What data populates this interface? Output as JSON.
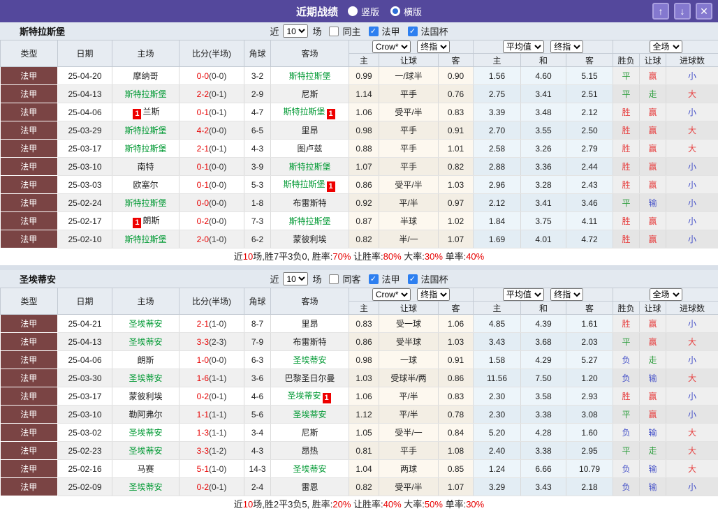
{
  "titlebar": {
    "title": "近期战绩",
    "radios": [
      {
        "label": "竖版",
        "selected": true
      },
      {
        "label": "横版",
        "selected": false
      }
    ],
    "buttons": {
      "up": "↑",
      "down": "↓",
      "close": "✕"
    }
  },
  "colors": {
    "topbar": "#54489c",
    "type_column": "#7a4444",
    "focus_team": "#009933",
    "score_red": "#e60000",
    "win_red": "#e64040",
    "draw_green": "#2f9e3f",
    "lose_blue": "#4450c8"
  },
  "header": {
    "cols": [
      "类型",
      "日期",
      "主场",
      "比分(半场)",
      "角球",
      "客场"
    ],
    "sub": [
      "主",
      "让球",
      "客",
      "主",
      "和",
      "客",
      "胜负",
      "让球",
      "进球数"
    ],
    "selects": {
      "crow": "Crow*",
      "final": "终指",
      "avg": "平均值",
      "full": "全场"
    }
  },
  "result_color_map": {
    "胜": "c-red",
    "平": "c-green",
    "负": "c-blue",
    "赢": "c-red",
    "走": "c-green",
    "输": "c-blue",
    "大": "c-red",
    "小": "c-blue"
  },
  "tables": [
    {
      "team": "斯特拉斯堡",
      "filter": {
        "near": "近",
        "count": "10",
        "games": "场",
        "checks": [
          {
            "label": "同主",
            "checked": false
          },
          {
            "label": "法甲",
            "checked": true
          },
          {
            "label": "法国杯",
            "checked": true
          }
        ]
      },
      "rows": [
        {
          "type": "法甲",
          "date": "25-04-20",
          "home": "摩纳哥",
          "home_focus": false,
          "home_card": "",
          "ft": "0-0",
          "ht": "(0-0)",
          "corner": "3-2",
          "away": "斯特拉斯堡",
          "away_focus": true,
          "away_card": "",
          "odds": [
            "0.99",
            "一/球半",
            "0.90"
          ],
          "avg": [
            "1.56",
            "4.60",
            "5.15"
          ],
          "results": [
            "平",
            "赢",
            "小"
          ]
        },
        {
          "type": "法甲",
          "date": "25-04-13",
          "home": "斯特拉斯堡",
          "home_focus": true,
          "home_card": "",
          "ft": "2-2",
          "ht": "(0-1)",
          "corner": "2-9",
          "away": "尼斯",
          "away_focus": false,
          "away_card": "",
          "odds": [
            "1.14",
            "平手",
            "0.76"
          ],
          "avg": [
            "2.75",
            "3.41",
            "2.51"
          ],
          "results": [
            "平",
            "走",
            "大"
          ]
        },
        {
          "type": "法甲",
          "date": "25-04-06",
          "home": "兰斯",
          "home_focus": false,
          "home_card": "before",
          "ft": "0-1",
          "ht": "(0-1)",
          "corner": "4-7",
          "away": "斯特拉斯堡",
          "away_focus": true,
          "away_card": "after",
          "odds": [
            "1.06",
            "受平/半",
            "0.83"
          ],
          "avg": [
            "3.39",
            "3.48",
            "2.12"
          ],
          "results": [
            "胜",
            "赢",
            "小"
          ]
        },
        {
          "type": "法甲",
          "date": "25-03-29",
          "home": "斯特拉斯堡",
          "home_focus": true,
          "home_card": "",
          "ft": "4-2",
          "ht": "(0-0)",
          "corner": "6-5",
          "away": "里昂",
          "away_focus": false,
          "away_card": "",
          "odds": [
            "0.98",
            "平手",
            "0.91"
          ],
          "avg": [
            "2.70",
            "3.55",
            "2.50"
          ],
          "results": [
            "胜",
            "赢",
            "大"
          ]
        },
        {
          "type": "法甲",
          "date": "25-03-17",
          "home": "斯特拉斯堡",
          "home_focus": true,
          "home_card": "",
          "ft": "2-1",
          "ht": "(0-1)",
          "corner": "4-3",
          "away": "图卢兹",
          "away_focus": false,
          "away_card": "",
          "odds": [
            "0.88",
            "平手",
            "1.01"
          ],
          "avg": [
            "2.58",
            "3.26",
            "2.79"
          ],
          "results": [
            "胜",
            "赢",
            "大"
          ]
        },
        {
          "type": "法甲",
          "date": "25-03-10",
          "home": "南特",
          "home_focus": false,
          "home_card": "",
          "ft": "0-1",
          "ht": "(0-0)",
          "corner": "3-9",
          "away": "斯特拉斯堡",
          "away_focus": true,
          "away_card": "",
          "odds": [
            "1.07",
            "平手",
            "0.82"
          ],
          "avg": [
            "2.88",
            "3.36",
            "2.44"
          ],
          "results": [
            "胜",
            "赢",
            "小"
          ]
        },
        {
          "type": "法甲",
          "date": "25-03-03",
          "home": "欧塞尔",
          "home_focus": false,
          "home_card": "",
          "ft": "0-1",
          "ht": "(0-0)",
          "corner": "5-3",
          "away": "斯特拉斯堡",
          "away_focus": true,
          "away_card": "after",
          "odds": [
            "0.86",
            "受平/半",
            "1.03"
          ],
          "avg": [
            "2.96",
            "3.28",
            "2.43"
          ],
          "results": [
            "胜",
            "赢",
            "小"
          ]
        },
        {
          "type": "法甲",
          "date": "25-02-24",
          "home": "斯特拉斯堡",
          "home_focus": true,
          "home_card": "",
          "ft": "0-0",
          "ht": "(0-0)",
          "corner": "1-8",
          "away": "布雷斯特",
          "away_focus": false,
          "away_card": "",
          "odds": [
            "0.92",
            "平/半",
            "0.97"
          ],
          "avg": [
            "2.12",
            "3.41",
            "3.46"
          ],
          "results": [
            "平",
            "输",
            "小"
          ]
        },
        {
          "type": "法甲",
          "date": "25-02-17",
          "home": "朗斯",
          "home_focus": false,
          "home_card": "before",
          "ft": "0-2",
          "ht": "(0-0)",
          "corner": "7-3",
          "away": "斯特拉斯堡",
          "away_focus": true,
          "away_card": "",
          "odds": [
            "0.87",
            "半球",
            "1.02"
          ],
          "avg": [
            "1.84",
            "3.75",
            "4.11"
          ],
          "results": [
            "胜",
            "赢",
            "小"
          ]
        },
        {
          "type": "法甲",
          "date": "25-02-10",
          "home": "斯特拉斯堡",
          "home_focus": true,
          "home_card": "",
          "ft": "2-0",
          "ht": "(1-0)",
          "corner": "6-2",
          "away": "蒙彼利埃",
          "away_focus": false,
          "away_card": "",
          "odds": [
            "0.82",
            "半/一",
            "1.07"
          ],
          "avg": [
            "1.69",
            "4.01",
            "4.72"
          ],
          "results": [
            "胜",
            "赢",
            "小"
          ]
        }
      ],
      "summary": [
        {
          "t": "近",
          "c": "k"
        },
        {
          "t": "10",
          "c": "r"
        },
        {
          "t": "场,胜7平3负0, 胜率:",
          "c": "k"
        },
        {
          "t": "70%",
          "c": "r"
        },
        {
          "t": " 让胜率:",
          "c": "k"
        },
        {
          "t": "80%",
          "c": "r"
        },
        {
          "t": " 大率:",
          "c": "k"
        },
        {
          "t": "30%",
          "c": "r"
        },
        {
          "t": " 单率:",
          "c": "k"
        },
        {
          "t": "40%",
          "c": "r"
        }
      ]
    },
    {
      "team": "圣埃蒂安",
      "filter": {
        "near": "近",
        "count": "10",
        "games": "场",
        "checks": [
          {
            "label": "同客",
            "checked": false
          },
          {
            "label": "法甲",
            "checked": true
          },
          {
            "label": "法国杯",
            "checked": true
          }
        ]
      },
      "rows": [
        {
          "type": "法甲",
          "date": "25-04-21",
          "home": "圣埃蒂安",
          "home_focus": true,
          "home_card": "",
          "ft": "2-1",
          "ht": "(1-0)",
          "corner": "8-7",
          "away": "里昂",
          "away_focus": false,
          "away_card": "",
          "odds": [
            "0.83",
            "受一球",
            "1.06"
          ],
          "avg": [
            "4.85",
            "4.39",
            "1.61"
          ],
          "results": [
            "胜",
            "赢",
            "小"
          ]
        },
        {
          "type": "法甲",
          "date": "25-04-13",
          "home": "圣埃蒂安",
          "home_focus": true,
          "home_card": "",
          "ft": "3-3",
          "ht": "(2-3)",
          "corner": "7-9",
          "away": "布雷斯特",
          "away_focus": false,
          "away_card": "",
          "odds": [
            "0.86",
            "受半球",
            "1.03"
          ],
          "avg": [
            "3.43",
            "3.68",
            "2.03"
          ],
          "results": [
            "平",
            "赢",
            "大"
          ]
        },
        {
          "type": "法甲",
          "date": "25-04-06",
          "home": "朗斯",
          "home_focus": false,
          "home_card": "",
          "ft": "1-0",
          "ht": "(0-0)",
          "corner": "6-3",
          "away": "圣埃蒂安",
          "away_focus": true,
          "away_card": "",
          "odds": [
            "0.98",
            "一球",
            "0.91"
          ],
          "avg": [
            "1.58",
            "4.29",
            "5.27"
          ],
          "results": [
            "负",
            "走",
            "小"
          ]
        },
        {
          "type": "法甲",
          "date": "25-03-30",
          "home": "圣埃蒂安",
          "home_focus": true,
          "home_card": "",
          "ft": "1-6",
          "ht": "(1-1)",
          "corner": "3-6",
          "away": "巴黎圣日尔曼",
          "away_focus": false,
          "away_card": "",
          "odds": [
            "1.03",
            "受球半/两",
            "0.86"
          ],
          "avg": [
            "11.56",
            "7.50",
            "1.20"
          ],
          "results": [
            "负",
            "输",
            "大"
          ]
        },
        {
          "type": "法甲",
          "date": "25-03-17",
          "home": "蒙彼利埃",
          "home_focus": false,
          "home_card": "",
          "ft": "0-2",
          "ht": "(0-1)",
          "corner": "4-6",
          "away": "圣埃蒂安",
          "away_focus": true,
          "away_card": "after",
          "odds": [
            "1.06",
            "平/半",
            "0.83"
          ],
          "avg": [
            "2.30",
            "3.58",
            "2.93"
          ],
          "results": [
            "胜",
            "赢",
            "小"
          ]
        },
        {
          "type": "法甲",
          "date": "25-03-10",
          "home": "勒阿弗尔",
          "home_focus": false,
          "home_card": "",
          "ft": "1-1",
          "ht": "(1-1)",
          "corner": "5-6",
          "away": "圣埃蒂安",
          "away_focus": true,
          "away_card": "",
          "odds": [
            "1.12",
            "平/半",
            "0.78"
          ],
          "avg": [
            "2.30",
            "3.38",
            "3.08"
          ],
          "results": [
            "平",
            "赢",
            "小"
          ]
        },
        {
          "type": "法甲",
          "date": "25-03-02",
          "home": "圣埃蒂安",
          "home_focus": true,
          "home_card": "",
          "ft": "1-3",
          "ht": "(1-1)",
          "corner": "3-4",
          "away": "尼斯",
          "away_focus": false,
          "away_card": "",
          "odds": [
            "1.05",
            "受半/一",
            "0.84"
          ],
          "avg": [
            "5.20",
            "4.28",
            "1.60"
          ],
          "results": [
            "负",
            "输",
            "大"
          ]
        },
        {
          "type": "法甲",
          "date": "25-02-23",
          "home": "圣埃蒂安",
          "home_focus": true,
          "home_card": "",
          "ft": "3-3",
          "ht": "(1-2)",
          "corner": "4-3",
          "away": "昂热",
          "away_focus": false,
          "away_card": "",
          "odds": [
            "0.81",
            "平手",
            "1.08"
          ],
          "avg": [
            "2.40",
            "3.38",
            "2.95"
          ],
          "results": [
            "平",
            "走",
            "大"
          ]
        },
        {
          "type": "法甲",
          "date": "25-02-16",
          "home": "马赛",
          "home_focus": false,
          "home_card": "",
          "ft": "5-1",
          "ht": "(1-0)",
          "corner": "14-3",
          "away": "圣埃蒂安",
          "away_focus": true,
          "away_card": "",
          "odds": [
            "1.04",
            "两球",
            "0.85"
          ],
          "avg": [
            "1.24",
            "6.66",
            "10.79"
          ],
          "results": [
            "负",
            "输",
            "大"
          ]
        },
        {
          "type": "法甲",
          "date": "25-02-09",
          "home": "圣埃蒂安",
          "home_focus": true,
          "home_card": "",
          "ft": "0-2",
          "ht": "(0-1)",
          "corner": "2-4",
          "away": "雷恩",
          "away_focus": false,
          "away_card": "",
          "odds": [
            "0.82",
            "受平/半",
            "1.07"
          ],
          "avg": [
            "3.29",
            "3.43",
            "2.18"
          ],
          "results": [
            "负",
            "输",
            "小"
          ]
        }
      ],
      "summary": [
        {
          "t": "近",
          "c": "k"
        },
        {
          "t": "10",
          "c": "r"
        },
        {
          "t": "场,胜2平3负5, 胜率:",
          "c": "k"
        },
        {
          "t": "20%",
          "c": "r"
        },
        {
          "t": " 让胜率:",
          "c": "k"
        },
        {
          "t": "40%",
          "c": "r"
        },
        {
          "t": " 大率:",
          "c": "k"
        },
        {
          "t": "50%",
          "c": "r"
        },
        {
          "t": " 单率:",
          "c": "k"
        },
        {
          "t": "30%",
          "c": "r"
        }
      ]
    }
  ]
}
